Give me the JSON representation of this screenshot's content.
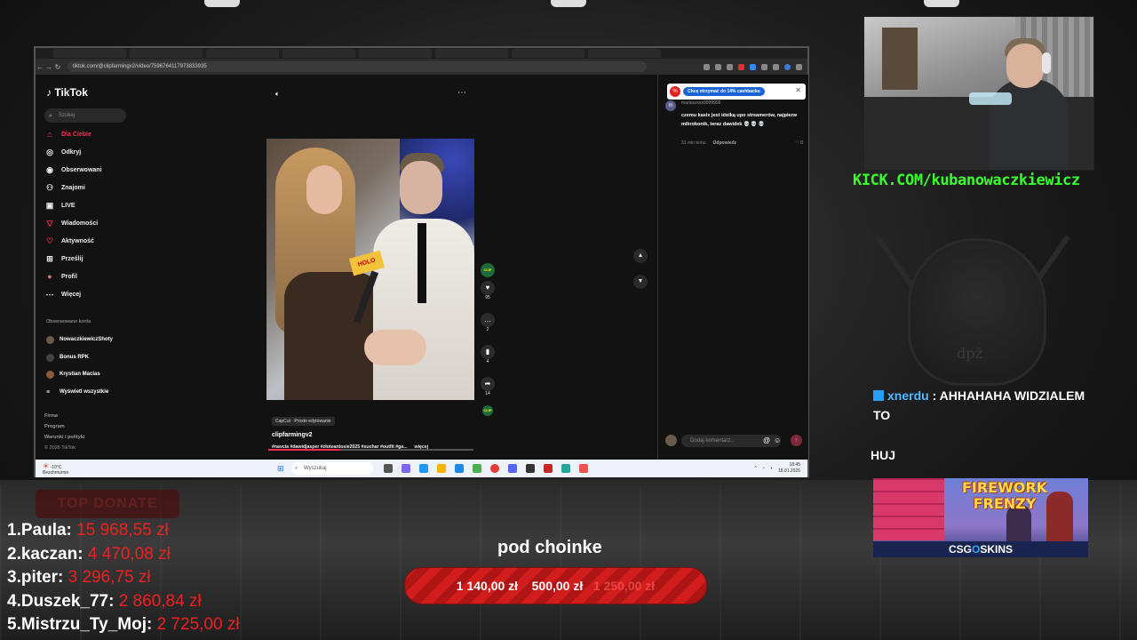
{
  "browser": {
    "url": "tiktok.com/@clipfarmingv2/video/7596764117973833935"
  },
  "tiktok": {
    "logo": "TikTok",
    "search_placeholder": "Szukaj",
    "nav": [
      {
        "label": "Dla Ciebie",
        "icon": "home-icon"
      },
      {
        "label": "Odkryj",
        "icon": "compass-icon"
      },
      {
        "label": "Obserwowani",
        "icon": "following-icon"
      },
      {
        "label": "Znajomi",
        "icon": "friends-icon"
      },
      {
        "label": "LIVE",
        "icon": "live-icon"
      },
      {
        "label": "Wiadomości",
        "icon": "messages-icon",
        "badge": "63"
      },
      {
        "label": "Aktywność",
        "icon": "activity-icon"
      },
      {
        "label": "Prześlij",
        "icon": "upload-icon"
      },
      {
        "label": "Profil",
        "icon": "profile-icon"
      },
      {
        "label": "Więcej",
        "icon": "more-icon"
      }
    ],
    "followed_heading": "Obserwowane konta",
    "followed": [
      "NowaczkiewiczShoty",
      "Bonus RPK",
      "Krystian Macias",
      "Wyświetl wszystkie"
    ],
    "footer": {
      "links": [
        "Firma",
        "Program",
        "Warunki i polityki"
      ],
      "copyright": "© 2026 TikTok"
    },
    "video": {
      "capcut_label": "CapCut · Proste edytowanie",
      "author": "clipfarmingv2",
      "tags": "#navcia #dawidjasper #złoteantosie2025 #suchar #outfit #ga...",
      "more": "więcej",
      "mic_text": "HOLO",
      "likes": "95",
      "comments": "2",
      "saves": "4",
      "shares": "14",
      "progress": 0.35
    },
    "cashback_pill": "Chcę otrzymać do 14% cashbacku",
    "comment": {
      "avatar_letter": "m",
      "user": "mariuszxxx9999999",
      "text": "czemu kasix jest idolką upo streamerów, najpierw mikrokonik, teraz dawidek 💀 💀 💀",
      "time": "31 min temu",
      "reply": "Odpowiedz",
      "likes": "0"
    },
    "comment_placeholder": "Dodaj komentarz..."
  },
  "taskbar": {
    "weather_temp": "-10°C",
    "weather_desc": "Bezchmurnie",
    "search_placeholder": "Wyszukaj",
    "time": "18:45",
    "date": "18.01.2026"
  },
  "stream": {
    "kick": "KICK.COM/kubanowaczkiewicz",
    "logo_text": "dpž",
    "chat": {
      "user": "xnerdu",
      "message": "AHHAHAHA WIDZIALEM TO"
    },
    "chat2": "HUJ",
    "ad": {
      "title": "FIREWORK FRENZY",
      "brand_a": "CSG",
      "brand_dot": "O",
      "brand_b": "SKINS"
    },
    "top_donate_label": "TOP DONATE",
    "donors": [
      {
        "rank": "1.",
        "name": "Paula:",
        "amount": "15 968,55 zł"
      },
      {
        "rank": "2.",
        "name": "kaczan:",
        "amount": "4 470,08 zł"
      },
      {
        "rank": "3.",
        "name": "piter:",
        "amount": "3 296,75 zł"
      },
      {
        "rank": "4.",
        "name": "Duszek_77:",
        "amount": "2 860,84 zł"
      },
      {
        "rank": "5.",
        "name": "Mistrzu_Ty_Moj:",
        "amount": "2 725,00 zł"
      }
    ],
    "goal": {
      "title": "pod choinke",
      "current": "1 140,00 zł",
      "separator": "500,00 zł",
      "target": "1 250,00 zł"
    }
  }
}
